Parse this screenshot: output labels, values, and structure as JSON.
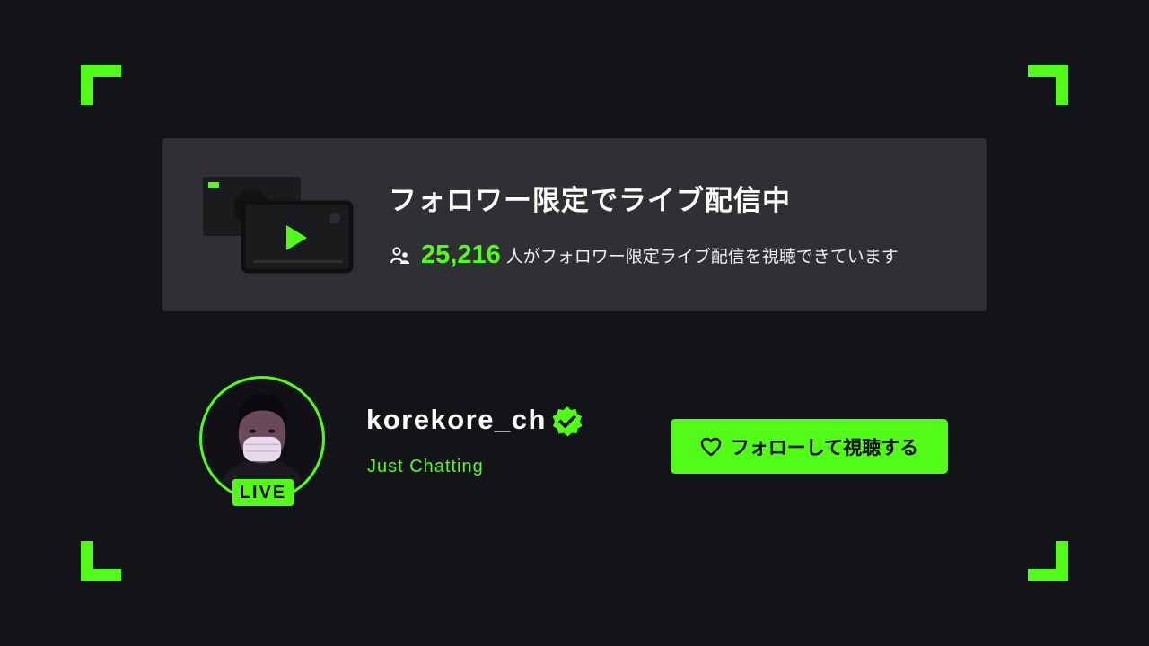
{
  "banner": {
    "title": "フォロワー限定でライブ配信中",
    "viewer_count": "25,216",
    "viewer_text": "人がフォロワー限定ライブ配信を視聴できています",
    "icons": {
      "viewers": "viewers-icon",
      "illustration": "stream-window-illustration"
    }
  },
  "channel": {
    "name": "korekore_ch",
    "category": "Just Chatting",
    "live_badge": "LIVE",
    "verified_icon": "verified-badge-icon"
  },
  "follow_button": {
    "label": "フォローして視聴する",
    "icon": "heart-icon"
  },
  "colors": {
    "accent": "#53fc18",
    "background": "#131417",
    "card": "#2f3033"
  }
}
